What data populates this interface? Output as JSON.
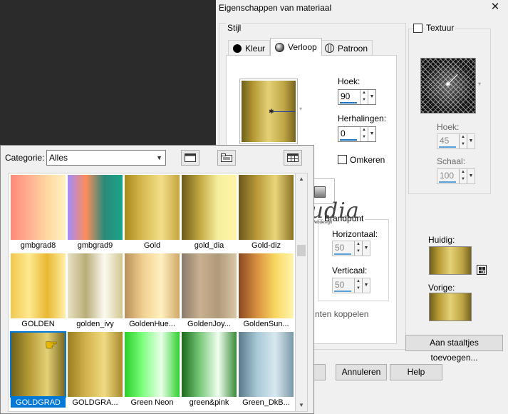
{
  "dialog": {
    "title": "Eigenschappen van materiaal",
    "style_group_label": "Stijl",
    "tabs": [
      {
        "label": "Kleur",
        "icon": "color-circle-icon"
      },
      {
        "label": "Verloop",
        "icon": "gradient-circle-icon"
      },
      {
        "label": "Patroon",
        "icon": "globe-pattern-icon"
      }
    ],
    "gradient": {
      "angle_label": "Hoek:",
      "angle_value": "90",
      "repeats_label": "Herhalingen:",
      "repeats_value": "0",
      "invert_label": "Omkeren"
    },
    "focal_point": {
      "label": "Brandpunt",
      "horizontal_label": "Horizontaal:",
      "horizontal_value": "50",
      "vertical_label": "Verticaal:",
      "vertical_value": "50",
      "link_label_partial": "nten koppelen"
    },
    "texture": {
      "label": "Textuur",
      "angle_label": "Hoek:",
      "angle_value": "45",
      "scale_label": "Schaal:",
      "scale_value": "100"
    },
    "current_label": "Huidig:",
    "previous_label": "Vorige:",
    "add_swatches_button": "Aan staaltjes toevoegen...",
    "cancel_button": "Annuleren",
    "help_button": "Help",
    "watermark": {
      "name": "Claudia",
      "sub": "CGSFWebdesign"
    }
  },
  "picker": {
    "category_label": "Categorie:",
    "category_value": "Alles",
    "gradients": [
      {
        "name": "gmbgrad8",
        "colors": [
          "#ff8a7a",
          "#ffb090",
          "#ffd8a0",
          "#fff0c0"
        ]
      },
      {
        "name": "gmbgrad9",
        "colors": [
          "#a08cff",
          "#ff8c5a",
          "#2a8a7a",
          "#1aa58a"
        ]
      },
      {
        "name": "Gold",
        "colors": [
          "#a8891e",
          "#d7bb52",
          "#f3df8a",
          "#c5a43d"
        ]
      },
      {
        "name": "gold_dia",
        "colors": [
          "#6d5a1a",
          "#c3a842",
          "#f7f0a0",
          "#fff3a8"
        ]
      },
      {
        "name": "Gold-diz",
        "colors": [
          "#6b581a",
          "#b89a38",
          "#e9d57c",
          "#8c7324"
        ]
      },
      {
        "name": "GOLDEN",
        "colors": [
          "#f0c850",
          "#ffe890",
          "#e8b830",
          "#fff0a8"
        ]
      },
      {
        "name": "golden_ivy",
        "colors": [
          "#e9e2c4",
          "#b8ad78",
          "#fcfaf0",
          "#d2c690"
        ]
      },
      {
        "name": "GoldenHue...",
        "colors": [
          "#b8905a",
          "#f0d090",
          "#fff0c0",
          "#d0a868"
        ]
      },
      {
        "name": "GoldenJoy...",
        "colors": [
          "#8a7a6a",
          "#c8b090",
          "#b09a7a",
          "#d8c8a8"
        ]
      },
      {
        "name": "GoldenSun...",
        "colors": [
          "#8a4820",
          "#d89040",
          "#f8d860",
          "#fff4b0"
        ]
      },
      {
        "name": "GOLDGRAD",
        "colors": [
          "#6e5f1a",
          "#b59a35",
          "#e4d177",
          "#76641d"
        ]
      },
      {
        "name": "GOLDGRA...",
        "colors": [
          "#9a7e22",
          "#d2b24c",
          "#f0da82",
          "#a8892c"
        ]
      },
      {
        "name": "Green Neon",
        "colors": [
          "#28d028",
          "#80ff80",
          "#e8ffe8",
          "#30d030"
        ]
      },
      {
        "name": "green&pink",
        "colors": [
          "#1a6a1a",
          "#7ac87a",
          "#f0fff0",
          "#3a8a3a"
        ]
      },
      {
        "name": "Green_DkB...",
        "colors": [
          "#5a7a8a",
          "#a8c8d8",
          "#d8e8f0",
          "#7a98a8"
        ]
      }
    ]
  },
  "colors": {
    "accent": "#0078d7",
    "dialog_bg": "#f0f0f0",
    "desktop_bg": "#2b2b2b"
  }
}
